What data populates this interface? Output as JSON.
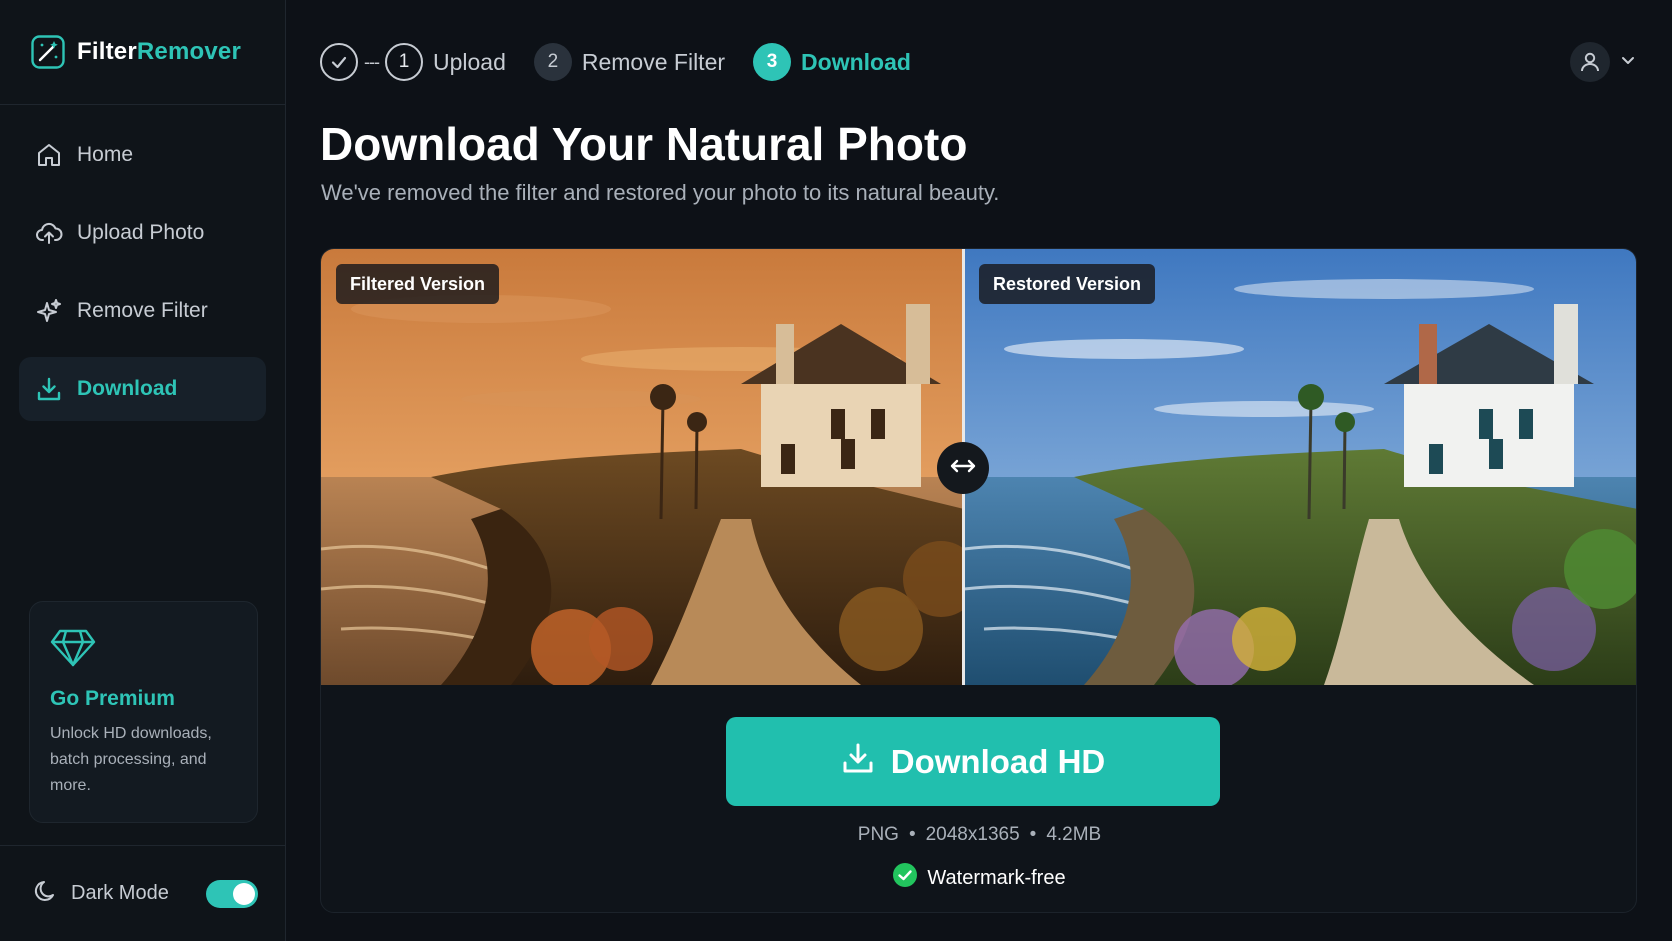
{
  "brand": {
    "name_part1": "Filter",
    "name_part2": "Remover"
  },
  "sidebar": {
    "items": [
      {
        "label": "Home",
        "icon": "home-icon",
        "active": false
      },
      {
        "label": "Upload Photo",
        "icon": "cloud-upload-icon",
        "active": false
      },
      {
        "label": "Remove Filter",
        "icon": "sparkles-icon",
        "active": false
      },
      {
        "label": "Download",
        "icon": "download-icon",
        "active": true
      }
    ],
    "premium": {
      "icon": "diamond-icon",
      "title": "Go Premium",
      "description": "Unlock HD downloads, batch processing, and more."
    },
    "dark_mode": {
      "label": "Dark Mode",
      "enabled": true
    }
  },
  "stepper": {
    "connector": "---",
    "steps": [
      {
        "number": "1",
        "label": "Upload",
        "state": "done"
      },
      {
        "number": "2",
        "label": "Remove Filter",
        "state": "done"
      },
      {
        "number": "3",
        "label": "Download",
        "state": "current"
      }
    ]
  },
  "main": {
    "title": "Download Your Natural Photo",
    "subtitle": "We've removed the filter and restored your photo to its natural beauty.",
    "compare": {
      "left_label": "Filtered Version",
      "right_label": "Restored Version",
      "slider_position": 0.49
    },
    "download_button": "Download HD",
    "file": {
      "format": "PNG",
      "dimensions": "2048x1365",
      "size": "4.2MB",
      "separator": "•"
    },
    "watermark_note": "Watermark-free"
  },
  "colors": {
    "accent": "#2ec4b6",
    "background": "#0d1117",
    "sidebar": "#0f1419",
    "button": "#21bfae"
  }
}
